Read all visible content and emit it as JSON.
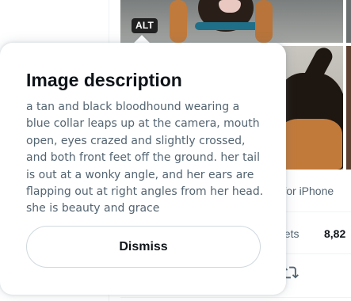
{
  "tweet": {
    "image_alt_badge": "ALT",
    "source_label": "er for iPhone",
    "stats_label": "eets",
    "stats_count": "8,82"
  },
  "modal": {
    "title": "Image description",
    "description": "a tan and black bloodhound wearing a blue collar leaps up at the camera, mouth open, eyes crazed and slightly crossed, and both front feet off the ground. her tail is out at a wonky angle, and her ears are flapping out at right angles from her head. she is beauty and grace",
    "dismiss_label": "Dismiss"
  },
  "icons": {
    "retweet": "retweet-icon"
  },
  "colors": {
    "accent": "#1d9bf0",
    "text_primary": "#0f1419",
    "text_secondary": "#536471",
    "border": "#cfd9de"
  }
}
